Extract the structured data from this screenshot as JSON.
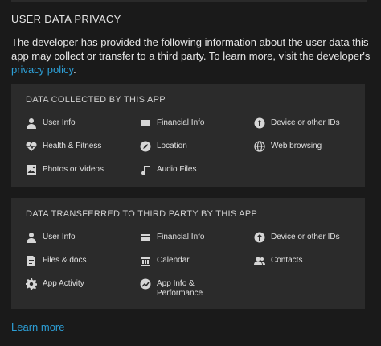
{
  "header": {
    "title": "USER DATA PRIVACY"
  },
  "description": {
    "text": "The developer has provided the following information about the user data this app may collect or transfer to a third party. To learn more, visit the developer's",
    "link_label": "privacy policy",
    "suffix": "."
  },
  "collected": {
    "title": "DATA COLLECTED BY THIS APP",
    "items": [
      {
        "label": "User Info",
        "icon": "user-icon"
      },
      {
        "label": "Financial Info",
        "icon": "card-icon"
      },
      {
        "label": "Device or other IDs",
        "icon": "device-id-icon"
      },
      {
        "label": "Health & Fitness",
        "icon": "heart-icon"
      },
      {
        "label": "Location",
        "icon": "compass-icon"
      },
      {
        "label": "Web browsing",
        "icon": "globe-icon"
      },
      {
        "label": "Photos or Videos",
        "icon": "image-icon"
      },
      {
        "label": "Audio Files",
        "icon": "music-icon"
      }
    ]
  },
  "transferred": {
    "title": "DATA TRANSFERRED TO THIRD PARTY BY THIS APP",
    "items": [
      {
        "label": "User Info",
        "icon": "user-icon"
      },
      {
        "label": "Financial Info",
        "icon": "card-icon"
      },
      {
        "label": "Device or other IDs",
        "icon": "device-id-icon"
      },
      {
        "label": "Files & docs",
        "icon": "file-icon"
      },
      {
        "label": "Calendar",
        "icon": "calendar-icon"
      },
      {
        "label": "Contacts",
        "icon": "contacts-icon"
      },
      {
        "label": "App Activity",
        "icon": "gear-icon"
      },
      {
        "label": "App Info & Performance",
        "icon": "performance-icon"
      }
    ]
  },
  "footer": {
    "learn_more": "Learn more"
  },
  "colors": {
    "background": "#1a1a1a",
    "card": "#2b2b2b",
    "link": "#2d9fd6"
  }
}
